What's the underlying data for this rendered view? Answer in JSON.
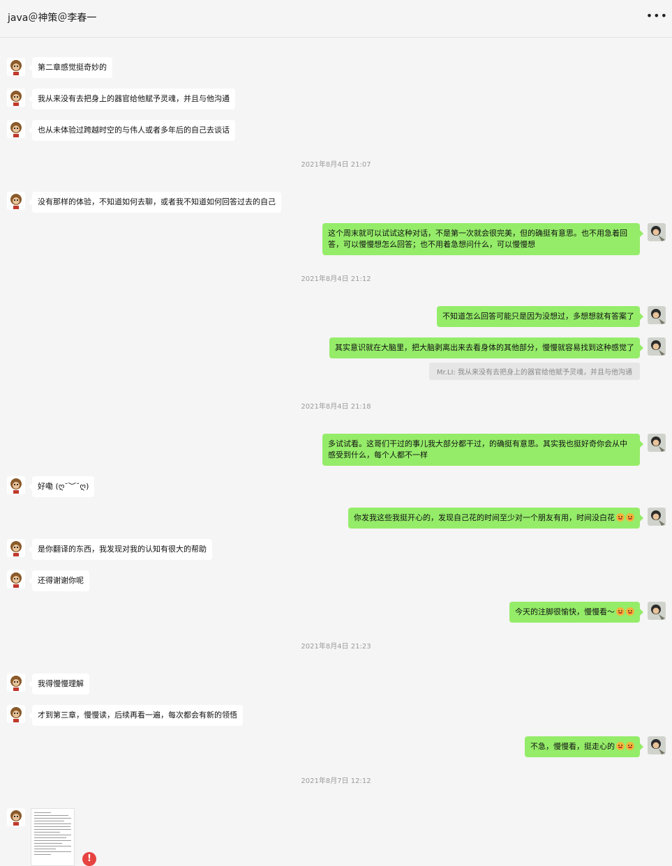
{
  "header": {
    "title": "java＠神策＠李春一",
    "more_icon": "more-horizontal-icon",
    "more_glyph": "•••"
  },
  "colors": {
    "self_bubble": "#95ec69",
    "other_bubble": "#ffffff",
    "background": "#f5f5f5",
    "error": "#e64340"
  },
  "messages": [
    {
      "side": "left",
      "text": "第二章感觉挺奇妙的"
    },
    {
      "side": "left",
      "text": "我从来没有去把身上的器官给他赋予灵魂，并且与他沟通"
    },
    {
      "side": "left",
      "text": "也从未体验过跨越时空的与伟人或者多年后的自己去谈话"
    },
    {
      "type": "timestamp",
      "text": "2021年8月4日 21:07"
    },
    {
      "side": "left",
      "text": "没有那样的体验，不知道如何去聊，或者我不知道如何回答过去的自己"
    },
    {
      "side": "right",
      "text": "这个周末就可以试试这种对话，不是第一次就会很完美，但的确挺有意思。也不用急着回答，可以慢慢想怎么回答；也不用着急想问什么，可以慢慢想"
    },
    {
      "type": "timestamp",
      "text": "2021年8月4日 21:12"
    },
    {
      "side": "right",
      "text": "不知道怎么回答可能只是因为没想过，多想想就有答案了"
    },
    {
      "side": "right",
      "text": "其实意识就在大脑里，把大脑剥离出来去看身体的其他部分，慢慢就容易找到这种感觉了"
    },
    {
      "type": "quote",
      "text": "Mr.LI: 我从来没有去把身上的器官给他赋予灵魂，并且与他沟通"
    },
    {
      "type": "timestamp",
      "text": "2021年8月4日 21:18"
    },
    {
      "side": "right",
      "text": "多试试看。这哥们干过的事儿我大部分都干过，的确挺有意思。其实我也挺好奇你会从中感受到什么，每个人都不一样"
    },
    {
      "side": "left",
      "text": "好嘞 (ღ˘︶˘ღ)"
    },
    {
      "side": "right",
      "text": "你发我这些我挺开心的，发现自己花的时间至少对一个朋友有用，时间没白花"
    },
    {
      "side": "left",
      "text": "是你翻译的东西，我发现对我的认知有很大的帮助"
    },
    {
      "side": "left",
      "text": "还得谢谢你呢"
    },
    {
      "side": "right",
      "text": "今天的注脚很愉快，慢慢看～"
    },
    {
      "type": "timestamp",
      "text": "2021年8月4日 21:23"
    },
    {
      "side": "left",
      "text": "我得慢慢理解"
    },
    {
      "side": "left",
      "text": "才到第三章，慢慢读，后续再看一遍，每次都会有新的领悟"
    },
    {
      "side": "right",
      "text": "不急，慢慢看，挺走心的"
    },
    {
      "type": "timestamp",
      "text": "2021年8月7日 12:12"
    },
    {
      "side": "left",
      "type": "image",
      "error_glyph": "!"
    }
  ]
}
